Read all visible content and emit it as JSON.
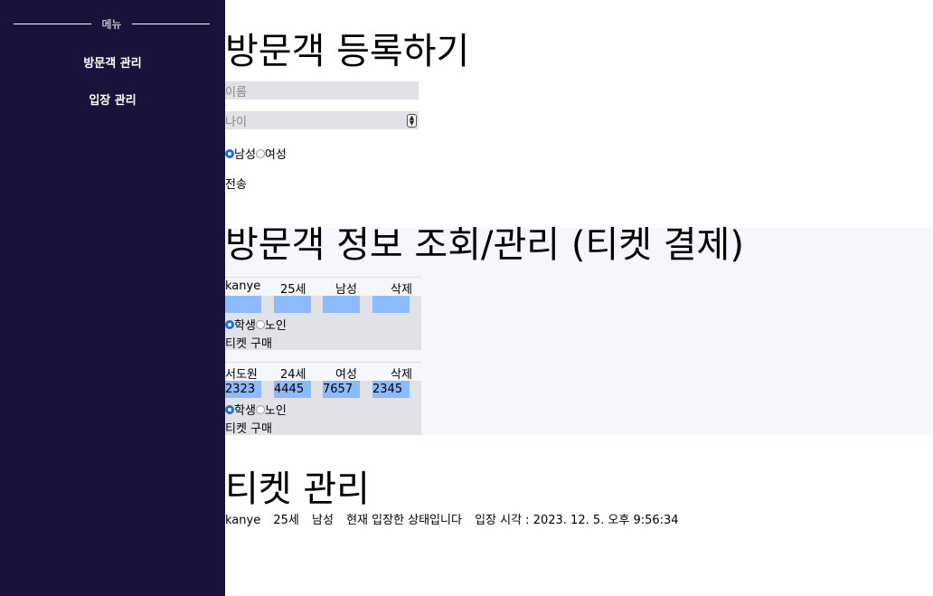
{
  "sidebar": {
    "menu_title": "메뉴",
    "items": [
      {
        "label": "방문객 관리"
      },
      {
        "label": "입장 관리"
      }
    ]
  },
  "register": {
    "title": "방문객 등록하기",
    "name_placeholder": "이름",
    "age_placeholder": "나이",
    "gender_options": [
      {
        "label": "남성",
        "checked": true
      },
      {
        "label": "여성",
        "checked": false
      }
    ],
    "submit_label": "전송"
  },
  "visitors": {
    "title": "방문객 정보 조회/관리 (티켓 결제)",
    "cards": [
      {
        "name": "kanye",
        "age": "25세",
        "gender": "남성",
        "delete_label": "삭제",
        "fields": [
          "",
          "",
          "",
          ""
        ],
        "ticket_options": [
          {
            "label": "학생",
            "checked": true
          },
          {
            "label": "노인",
            "checked": false
          }
        ],
        "buy_label": "티켓 구매"
      },
      {
        "name": "서도원",
        "age": "24세",
        "gender": "여성",
        "delete_label": "삭제",
        "fields": [
          "2323",
          "4445",
          "7657",
          "2345"
        ],
        "ticket_options": [
          {
            "label": "학생",
            "checked": true
          },
          {
            "label": "노인",
            "checked": false
          }
        ],
        "buy_label": "티켓 구매"
      }
    ]
  },
  "tickets": {
    "title": "티켓 관리",
    "entries": [
      {
        "name": "kanye",
        "age": "25세",
        "gender": "남성",
        "status": "현재 입장한 상태입니다",
        "entry_time": "입장 시각 : 2023. 12. 5. 오후 9:56:34"
      }
    ]
  },
  "colors": {
    "sidebar_bg": "#18133a",
    "panel_bg": "#f4f7fb",
    "input_bg": "#e1e2e7",
    "highlight": "#8cbafa",
    "radio_accent": "#1a6cf0"
  }
}
